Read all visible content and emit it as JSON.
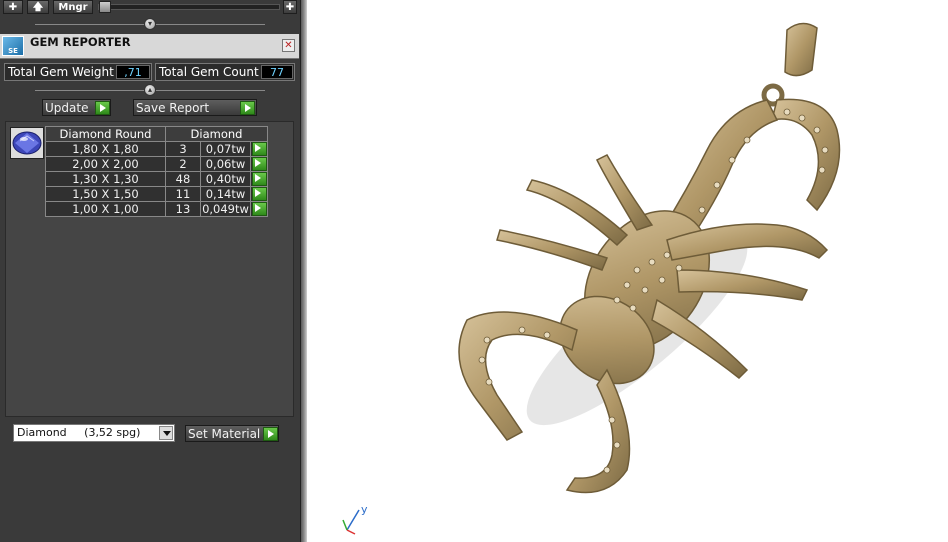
{
  "toolbar": {
    "add_icon": "plus-icon",
    "up_icon": "up-arrow-icon",
    "mngr_label": "Mngr",
    "right_icon": "plus-icon",
    "slider_value": 0
  },
  "gem_reporter": {
    "title": "GEM REPORTER",
    "logo_text": "SE",
    "total_weight_label": "Total Gem Weight",
    "total_weight_value": ",71",
    "total_count_label": "Total Gem Count",
    "total_count_value": "77",
    "update_label": "Update",
    "save_report_label": "Save Report"
  },
  "table": {
    "headers": [
      "Diamond Round",
      "Diamond"
    ],
    "rows": [
      {
        "size": "1,80 X 1,80",
        "count": "3",
        "weight": "0,07tw"
      },
      {
        "size": "2,00 X 2,00",
        "count": "2",
        "weight": "0,06tw"
      },
      {
        "size": "1,30 X 1,30",
        "count": "48",
        "weight": "0,40tw"
      },
      {
        "size": "1,50 X 1,50",
        "count": "11",
        "weight": "0,14tw"
      },
      {
        "size": "1,00 X 1,00",
        "count": "13",
        "weight": "0,049tw"
      }
    ]
  },
  "material": {
    "selected": "Diamond     (3,52 spg)",
    "set_label": "Set Material"
  },
  "viewport": {
    "axis_label": "y",
    "model_color": "#b79f72"
  }
}
